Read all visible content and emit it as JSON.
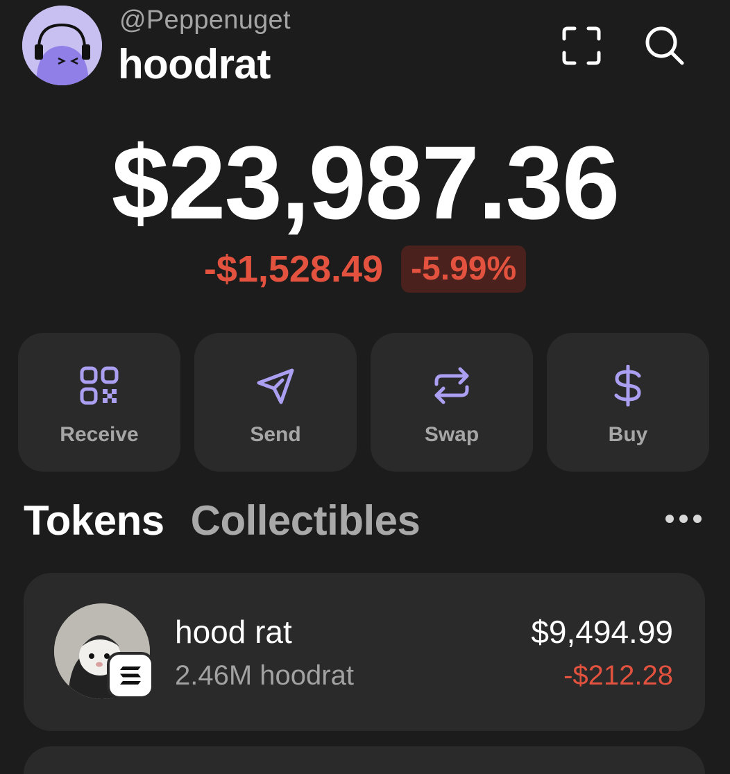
{
  "header": {
    "handle": "@Peppenuget",
    "account_name": "hoodrat",
    "avatar_icon": "headphones-face-avatar",
    "scan_icon": "scan-frame-icon",
    "search_icon": "search-icon"
  },
  "balance": {
    "total": "$23,987.36",
    "change_amount": "-$1,528.49",
    "change_percent": "-5.99%"
  },
  "actions": [
    {
      "label": "Receive",
      "icon": "qr-code-icon"
    },
    {
      "label": "Send",
      "icon": "send-plane-icon"
    },
    {
      "label": "Swap",
      "icon": "swap-arrows-icon"
    },
    {
      "label": "Buy",
      "icon": "dollar-icon"
    }
  ],
  "tabs": {
    "active": "Tokens",
    "inactive": "Collectibles",
    "more_icon": "more-dots-icon"
  },
  "tokens": [
    {
      "name": "hood rat",
      "amount": "2.46M hoodrat",
      "value": "$9,494.99",
      "change": "-$212.28",
      "chain_icon": "solana-icon"
    }
  ],
  "colors": {
    "background": "#1c1c1c",
    "card": "#2a2a2a",
    "accent": "#ab9ff2",
    "negative": "#e2523e",
    "negative_bg": "#4a211c"
  }
}
